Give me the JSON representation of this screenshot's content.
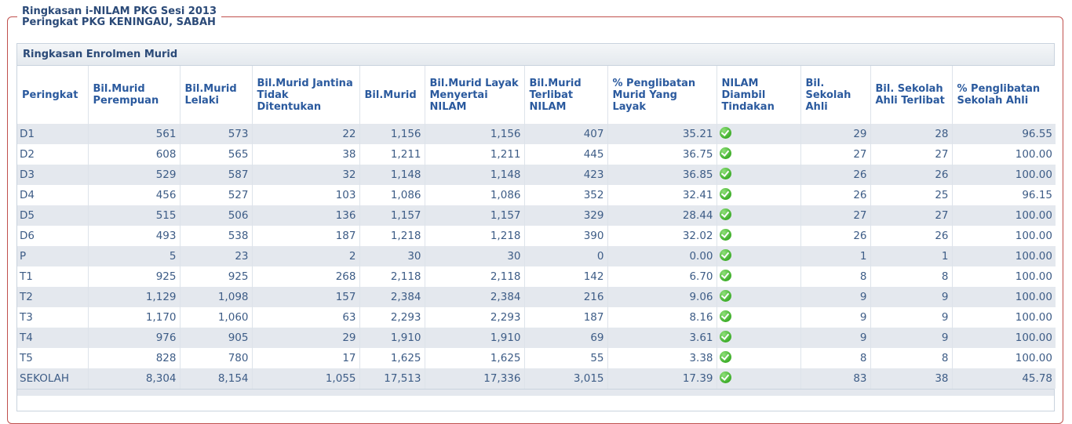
{
  "legend": {
    "line1": "Ringkasan i-NILAM PKG Sesi 2013",
    "line2": "Peringkat PKG KENINGAU, SABAH"
  },
  "panel": {
    "title": "Ringkasan Enrolmen Murid"
  },
  "columns": [
    "Peringkat",
    "Bil.Murid Perempuan",
    "Bil.Murid Lelaki",
    "Bil.Murid Jantina Tidak Ditentukan",
    "Bil.Murid",
    "Bil.Murid Layak Menyertai NILAM",
    "Bil.Murid Terlibat NILAM",
    "% Penglibatan Murid Yang Layak",
    "NILAM Diambil Tindakan",
    "Bil. Sekolah Ahli",
    "Bil. Sekolah Ahli Terlibat",
    "% Penglibatan Sekolah Ahli"
  ],
  "rows": [
    {
      "label": "D1",
      "perempuan": "561",
      "lelaki": "573",
      "tidak": "22",
      "murid": "1,156",
      "layak": "1,156",
      "terlibat": "407",
      "pct": "35.21",
      "sekolah": "29",
      "sekolah_terlibat": "28",
      "pct_sekolah": "96.55"
    },
    {
      "label": "D2",
      "perempuan": "608",
      "lelaki": "565",
      "tidak": "38",
      "murid": "1,211",
      "layak": "1,211",
      "terlibat": "445",
      "pct": "36.75",
      "sekolah": "27",
      "sekolah_terlibat": "27",
      "pct_sekolah": "100.00"
    },
    {
      "label": "D3",
      "perempuan": "529",
      "lelaki": "587",
      "tidak": "32",
      "murid": "1,148",
      "layak": "1,148",
      "terlibat": "423",
      "pct": "36.85",
      "sekolah": "26",
      "sekolah_terlibat": "26",
      "pct_sekolah": "100.00"
    },
    {
      "label": "D4",
      "perempuan": "456",
      "lelaki": "527",
      "tidak": "103",
      "murid": "1,086",
      "layak": "1,086",
      "terlibat": "352",
      "pct": "32.41",
      "sekolah": "26",
      "sekolah_terlibat": "25",
      "pct_sekolah": "96.15"
    },
    {
      "label": "D5",
      "perempuan": "515",
      "lelaki": "506",
      "tidak": "136",
      "murid": "1,157",
      "layak": "1,157",
      "terlibat": "329",
      "pct": "28.44",
      "sekolah": "27",
      "sekolah_terlibat": "27",
      "pct_sekolah": "100.00"
    },
    {
      "label": "D6",
      "perempuan": "493",
      "lelaki": "538",
      "tidak": "187",
      "murid": "1,218",
      "layak": "1,218",
      "terlibat": "390",
      "pct": "32.02",
      "sekolah": "26",
      "sekolah_terlibat": "26",
      "pct_sekolah": "100.00"
    },
    {
      "label": "P",
      "perempuan": "5",
      "lelaki": "23",
      "tidak": "2",
      "murid": "30",
      "layak": "30",
      "terlibat": "0",
      "pct": "0.00",
      "sekolah": "1",
      "sekolah_terlibat": "1",
      "pct_sekolah": "100.00"
    },
    {
      "label": "T1",
      "perempuan": "925",
      "lelaki": "925",
      "tidak": "268",
      "murid": "2,118",
      "layak": "2,118",
      "terlibat": "142",
      "pct": "6.70",
      "sekolah": "8",
      "sekolah_terlibat": "8",
      "pct_sekolah": "100.00"
    },
    {
      "label": "T2",
      "perempuan": "1,129",
      "lelaki": "1,098",
      "tidak": "157",
      "murid": "2,384",
      "layak": "2,384",
      "terlibat": "216",
      "pct": "9.06",
      "sekolah": "9",
      "sekolah_terlibat": "9",
      "pct_sekolah": "100.00"
    },
    {
      "label": "T3",
      "perempuan": "1,170",
      "lelaki": "1,060",
      "tidak": "63",
      "murid": "2,293",
      "layak": "2,293",
      "terlibat": "187",
      "pct": "8.16",
      "sekolah": "9",
      "sekolah_terlibat": "9",
      "pct_sekolah": "100.00"
    },
    {
      "label": "T4",
      "perempuan": "976",
      "lelaki": "905",
      "tidak": "29",
      "murid": "1,910",
      "layak": "1,910",
      "terlibat": "69",
      "pct": "3.61",
      "sekolah": "9",
      "sekolah_terlibat": "9",
      "pct_sekolah": "100.00"
    },
    {
      "label": "T5",
      "perempuan": "828",
      "lelaki": "780",
      "tidak": "17",
      "murid": "1,625",
      "layak": "1,625",
      "terlibat": "55",
      "pct": "3.38",
      "sekolah": "8",
      "sekolah_terlibat": "8",
      "pct_sekolah": "100.00"
    },
    {
      "label": "SEKOLAH",
      "perempuan": "8,304",
      "lelaki": "8,154",
      "tidak": "1,055",
      "murid": "17,513",
      "layak": "17,336",
      "terlibat": "3,015",
      "pct": "17.39",
      "sekolah": "83",
      "sekolah_terlibat": "38",
      "pct_sekolah": "45.78"
    }
  ],
  "action_icon": "check-circle-icon",
  "colors": {
    "frame_border": "#c0504d",
    "header_text": "#2b5a9e",
    "row_stripe": "#e4e8ee",
    "check_green": "#3fae2b"
  }
}
